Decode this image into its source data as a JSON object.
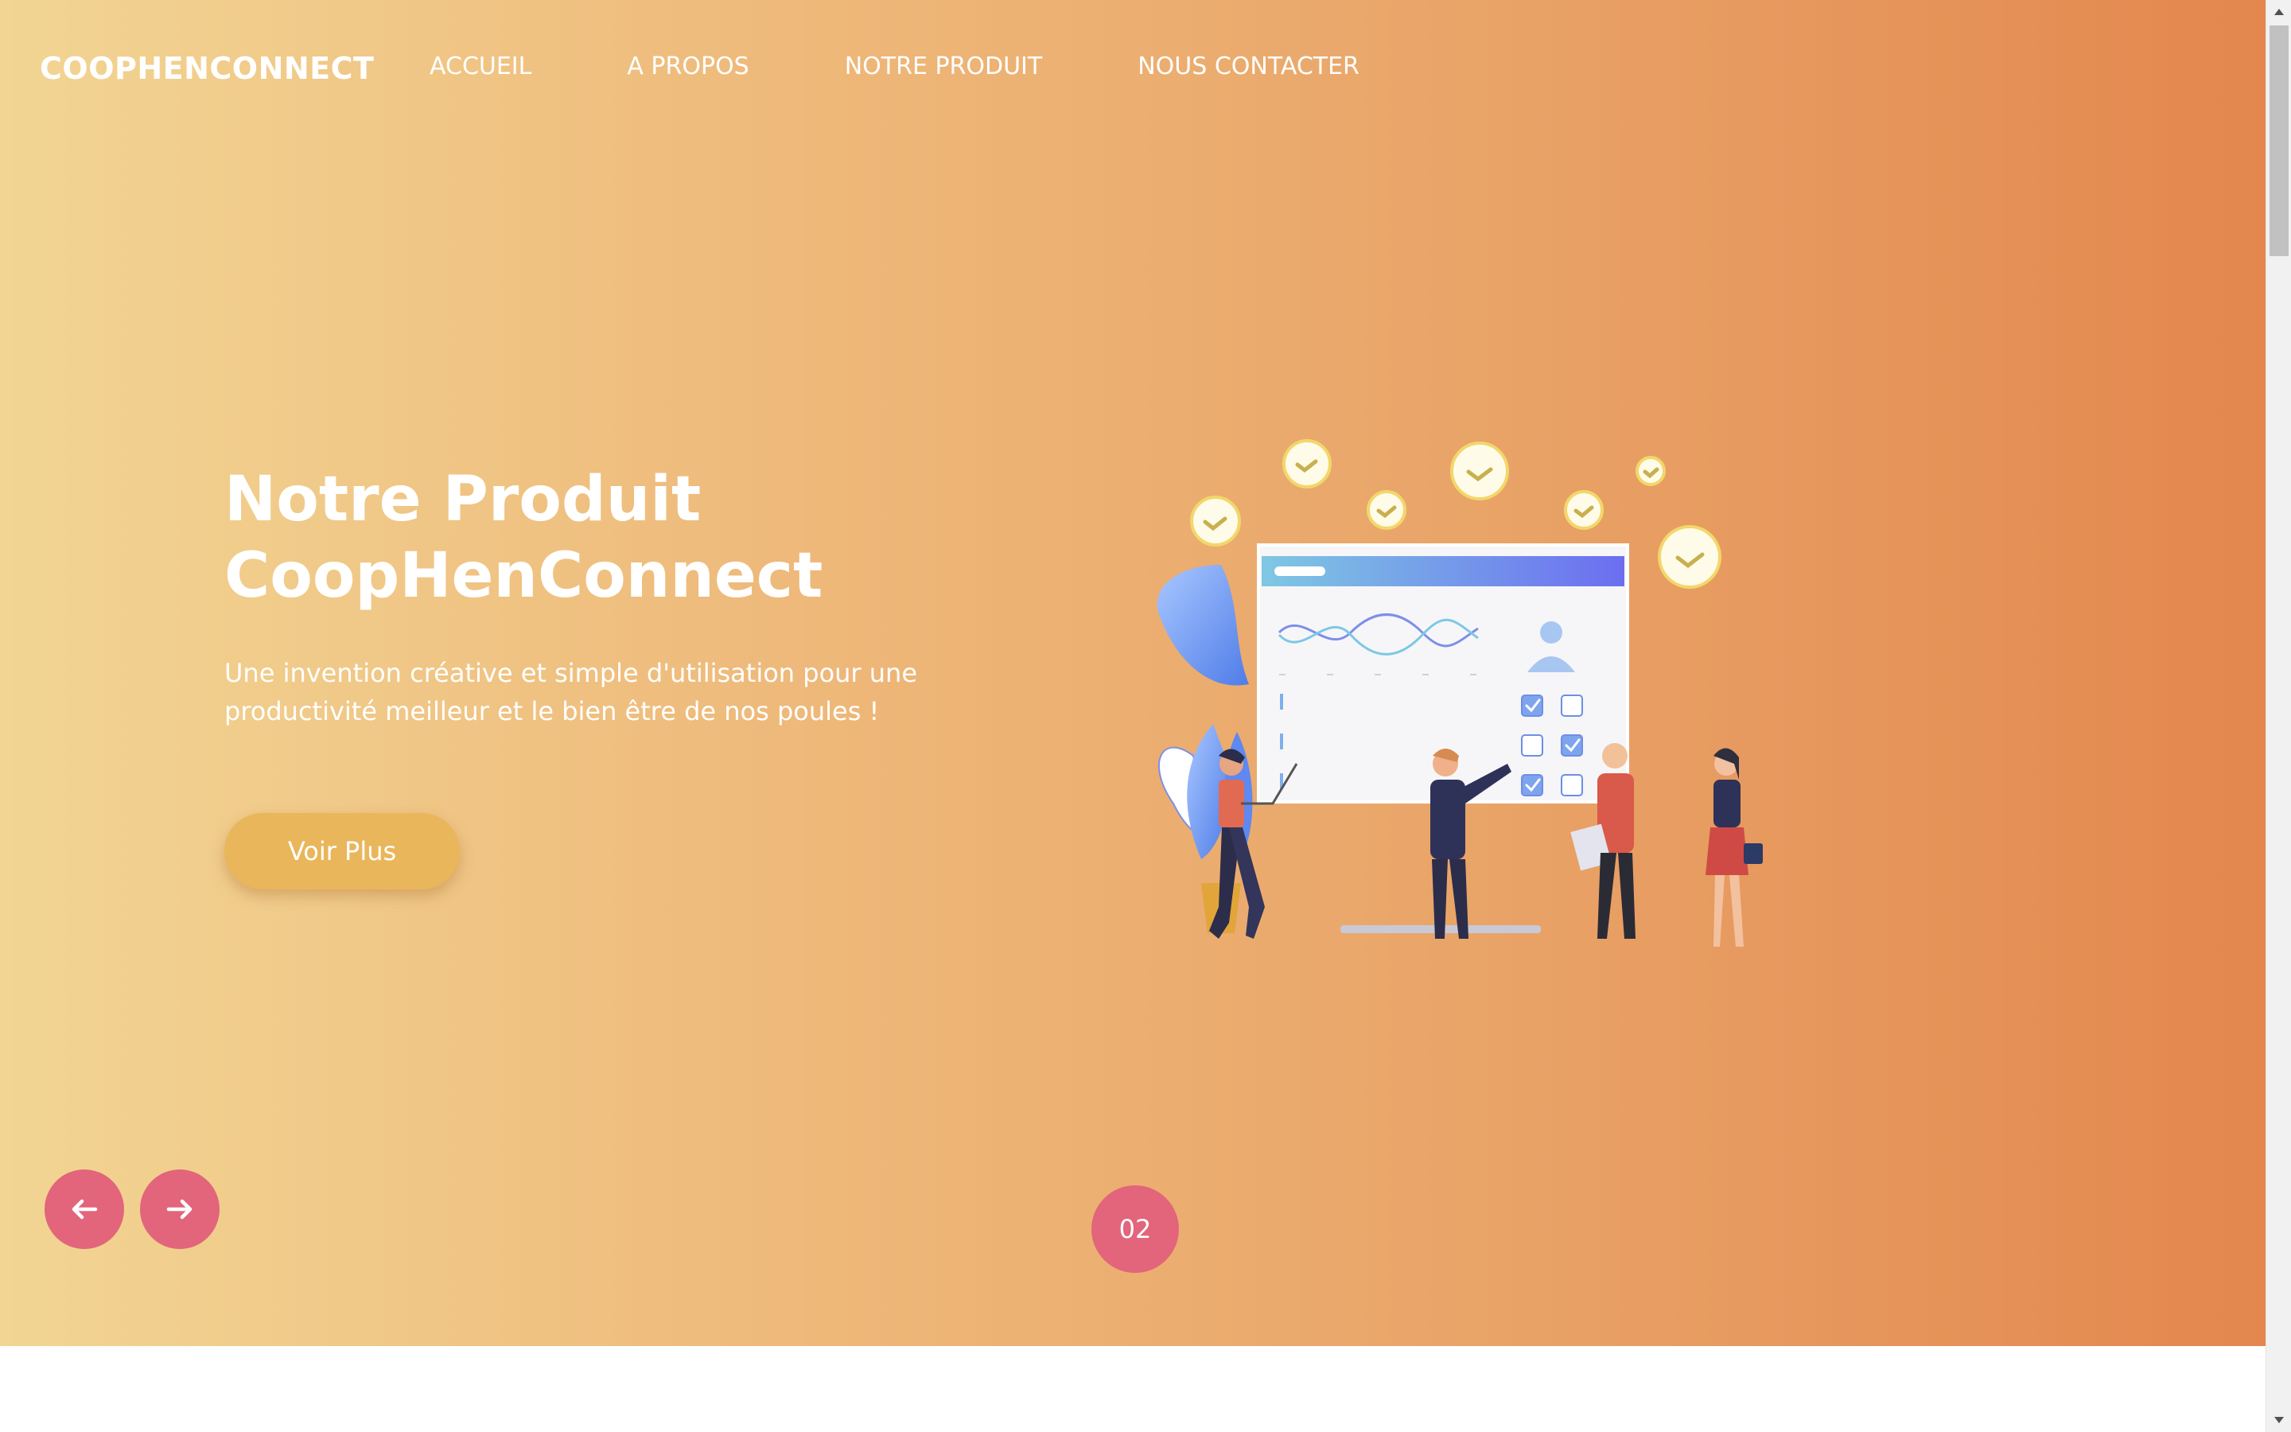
{
  "header": {
    "logo": "COOPHENCONNECT",
    "nav": [
      {
        "label": "ACCUEIL"
      },
      {
        "label": "A PROPOS"
      },
      {
        "label": "NOTRE PRODUIT"
      },
      {
        "label": "NOUS CONTACTER"
      }
    ]
  },
  "hero": {
    "title_line1": "Notre Produit",
    "title_line2": "CoopHenConnect",
    "description": "Une invention créative et simple d'utilisation pour une productivité meilleur et le bien être de nos poules !",
    "cta_label": "Voir Plus"
  },
  "slider": {
    "current_slide": "02",
    "prev_icon": "arrow-left-icon",
    "next_icon": "arrow-right-icon"
  },
  "colors": {
    "gradient_start": "#f2d593",
    "gradient_end": "#e3874e",
    "accent_pink": "#e2657c",
    "cta_yellow": "#eab65b"
  }
}
